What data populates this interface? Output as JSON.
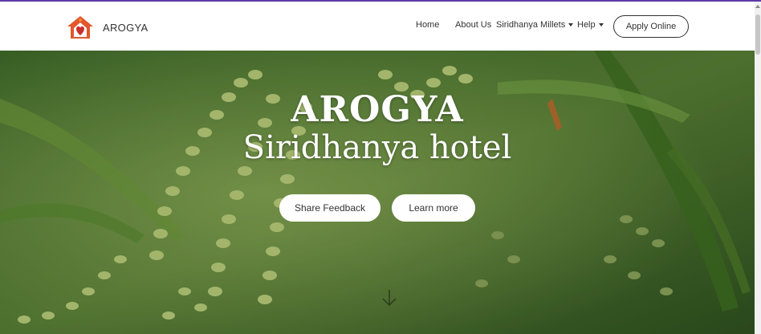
{
  "brand": {
    "name": "AROGYA",
    "logo_icon": "house-heart-logo-icon"
  },
  "nav": {
    "home": "Home",
    "about": "About Us",
    "millets": "Siridhanya Millets",
    "help": "Help",
    "apply": "Apply Online"
  },
  "hero": {
    "title": "AROGYA",
    "subtitle": "Siridhanya hotel",
    "feedback_button": "Share Feedback",
    "learn_button": "Learn more",
    "scroll_icon": "arrow-down-icon"
  },
  "colors": {
    "accent_line": "#5b3aa8",
    "logo_orange": "#e2572b",
    "logo_red": "#c9302c"
  }
}
